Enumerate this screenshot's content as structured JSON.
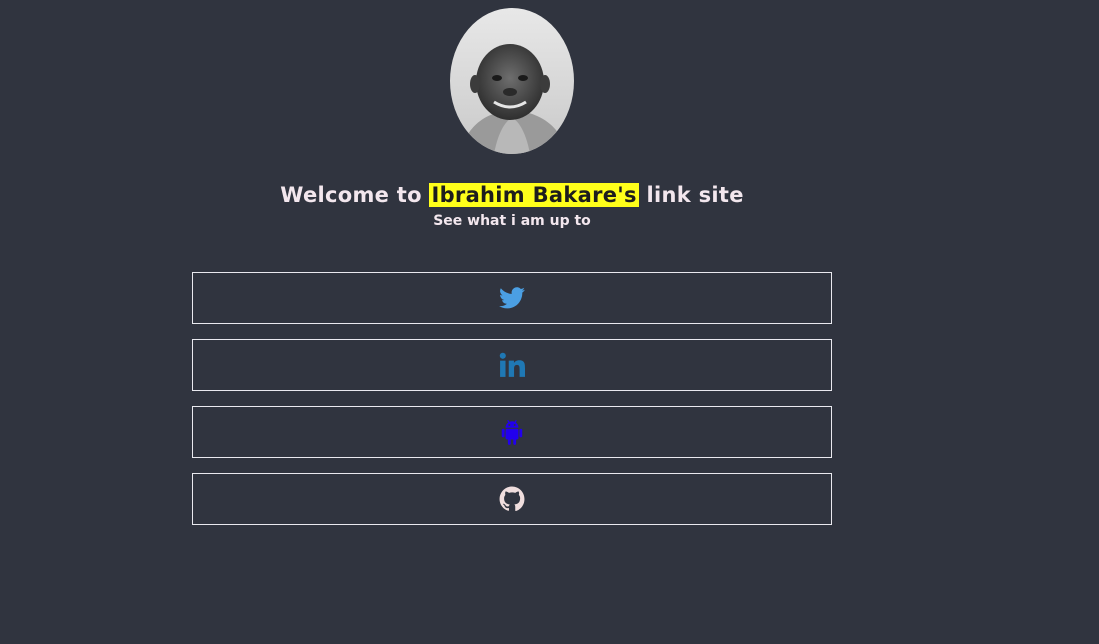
{
  "profile": {
    "avatar_alt": "profile photo"
  },
  "header": {
    "title_prefix": "Welcome to ",
    "title_name": "Ibrahim Bakare's",
    "title_suffix": " link site",
    "subtitle": "See what i am up to"
  },
  "links": [
    {
      "icon": "twitter-icon",
      "color": "#4b9fe3"
    },
    {
      "icon": "linkedin-icon",
      "color": "#1f78b4"
    },
    {
      "icon": "android-icon",
      "color": "#2200ee"
    },
    {
      "icon": "github-icon",
      "color": "#f0dede"
    }
  ],
  "colors": {
    "background": "#30343f",
    "highlight": "#ffff1a",
    "text": "#f3e7ee",
    "border": "#e9e9ef"
  }
}
